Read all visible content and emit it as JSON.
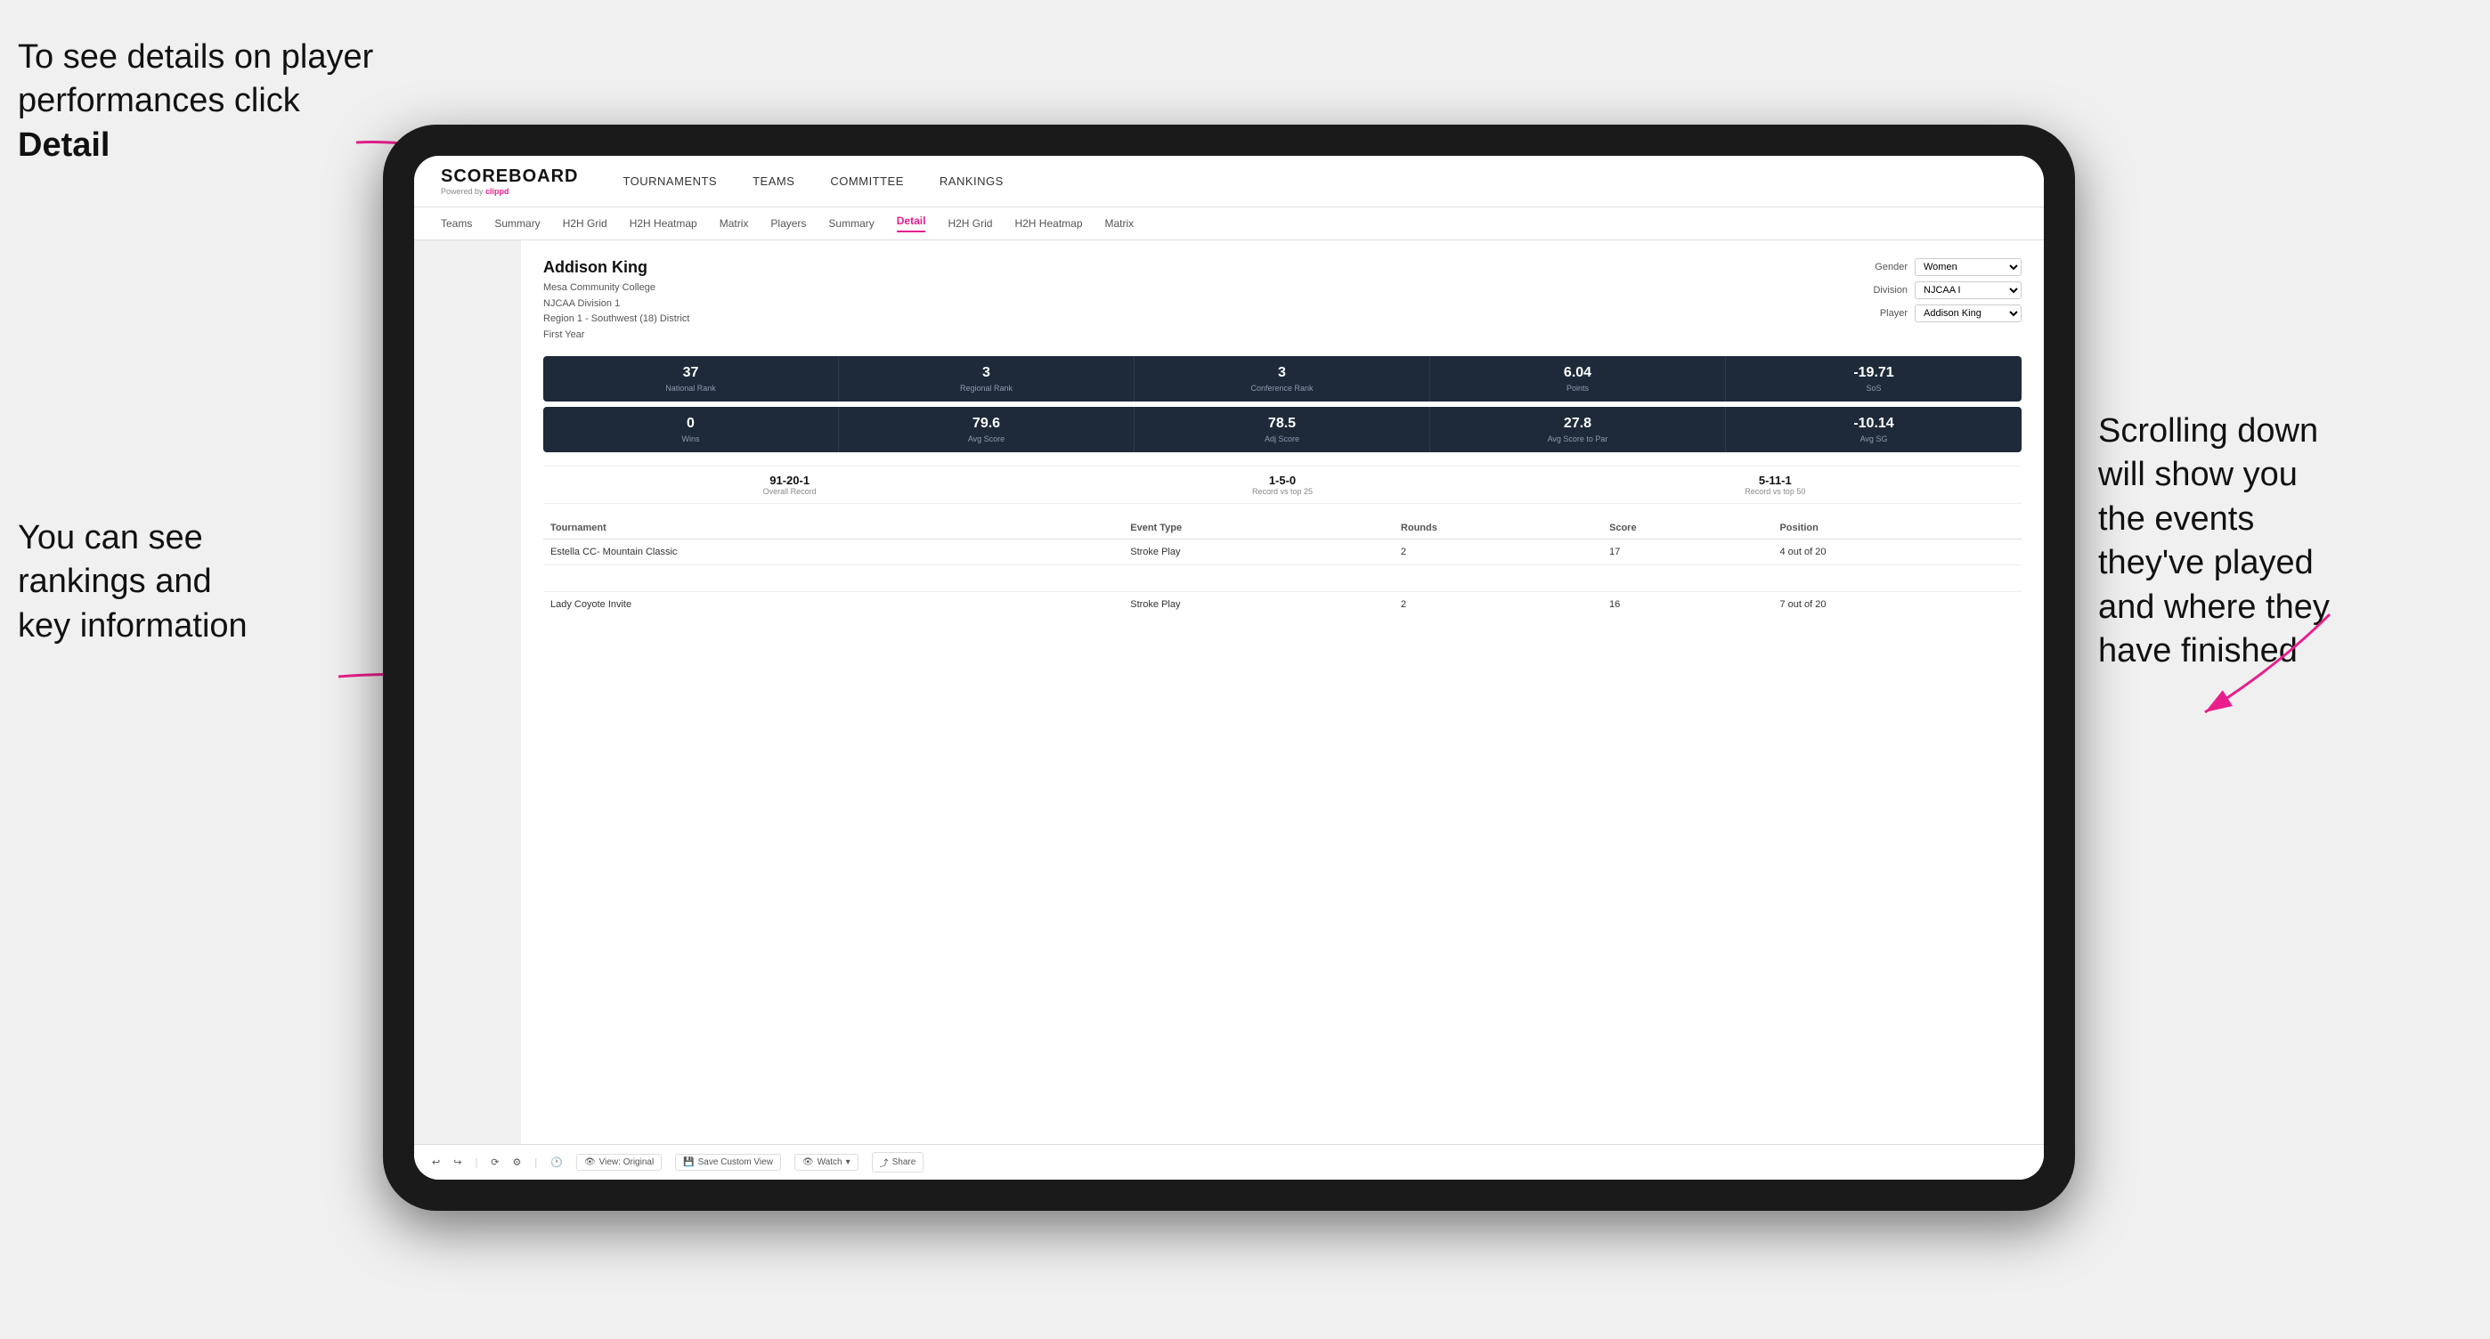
{
  "annotations": {
    "top_left": "To see details on player performances click ",
    "top_left_bold": "Detail",
    "bottom_left_line1": "You can see",
    "bottom_left_line2": "rankings and",
    "bottom_left_line3": "key information",
    "right_line1": "Scrolling down",
    "right_line2": "will show you",
    "right_line3": "the events",
    "right_line4": "they've played",
    "right_line5": "and where they",
    "right_line6": "have finished"
  },
  "nav": {
    "logo": "SCOREBOARD",
    "powered_by": "Powered by ",
    "clippd": "clippd",
    "items": [
      "TOURNAMENTS",
      "TEAMS",
      "COMMITTEE",
      "RANKINGS"
    ]
  },
  "second_nav": {
    "items": [
      "Teams",
      "Summary",
      "H2H Grid",
      "H2H Heatmap",
      "Matrix",
      "Players",
      "Summary",
      "Detail",
      "H2H Grid",
      "H2H Heatmap",
      "Matrix"
    ],
    "active": "Detail"
  },
  "player": {
    "name": "Addison King",
    "college": "Mesa Community College",
    "division": "NJCAA Division 1",
    "region": "Region 1 - Southwest (18) District",
    "year": "First Year",
    "filters": {
      "gender_label": "Gender",
      "gender_value": "Women",
      "division_label": "Division",
      "division_value": "NJCAA I",
      "player_label": "Player",
      "player_value": "Addison King"
    }
  },
  "stats_row1": [
    {
      "value": "37",
      "label": "National Rank"
    },
    {
      "value": "3",
      "label": "Regional Rank"
    },
    {
      "value": "3",
      "label": "Conference Rank"
    },
    {
      "value": "6.04",
      "label": "Points"
    },
    {
      "value": "-19.71",
      "label": "SoS"
    }
  ],
  "stats_row2": [
    {
      "value": "0",
      "label": "Wins"
    },
    {
      "value": "79.6",
      "label": "Avg Score"
    },
    {
      "value": "78.5",
      "label": "Adj Score"
    },
    {
      "value": "27.8",
      "label": "Avg Score to Par"
    },
    {
      "value": "-10.14",
      "label": "Avg SG"
    }
  ],
  "records": [
    {
      "value": "91-20-1",
      "label": "Overall Record"
    },
    {
      "value": "1-5-0",
      "label": "Record vs top 25"
    },
    {
      "value": "5-11-1",
      "label": "Record vs top 50"
    }
  ],
  "table": {
    "headers": [
      "Tournament",
      "Event Type",
      "Rounds",
      "Score",
      "Position"
    ],
    "rows": [
      {
        "tournament": "Estella CC- Mountain Classic",
        "event_type": "Stroke Play",
        "rounds": "2",
        "score": "17",
        "position": "4 out of 20"
      },
      {
        "tournament": "",
        "event_type": "",
        "rounds": "",
        "score": "",
        "position": ""
      },
      {
        "tournament": "Lady Coyote Invite",
        "event_type": "Stroke Play",
        "rounds": "2",
        "score": "16",
        "position": "7 out of 20"
      }
    ]
  },
  "toolbar": {
    "view_original": "View: Original",
    "save_custom": "Save Custom View",
    "watch": "Watch",
    "share": "Share"
  }
}
